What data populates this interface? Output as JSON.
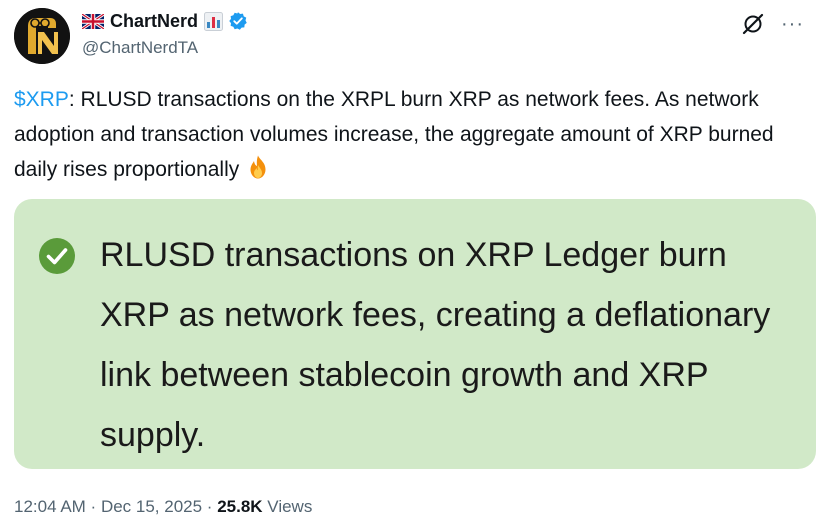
{
  "author": {
    "flag_icon": "uk-flag-icon",
    "display_name": "ChartNerd",
    "name_emoji_icon": "bar-chart-icon",
    "verified_icon": "verified-badge-icon",
    "handle": "@ChartNerdTA",
    "avatar_icon": "chartnerd-avatar-icon"
  },
  "actions": {
    "grok_icon": "grok-icon",
    "more_label": "···"
  },
  "tweet": {
    "cashtag": "$XRP",
    "body": ": RLUSD transactions on the XRPL burn XRP as network fees. As network adoption and transaction volumes increase, the aggregate amount of XRP burned daily rises proportionally",
    "trailing_emoji_icon": "fire-icon"
  },
  "card": {
    "icon": "check-mark-icon",
    "text": "RLUSD transactions on XRP Ledger burn XRP as network fees, creating a deflationary link between stablecoin growth and XRP supply.",
    "background_color": "#d1e9c8"
  },
  "footer": {
    "time": "12:04 AM",
    "separator": " · ",
    "date": "Dec 15, 2025",
    "views_count": "25.8K",
    "views_label": " Views"
  },
  "colors": {
    "link": "#1d9bf0",
    "secondary_text": "#536471",
    "check_green": "#5a9b3a"
  }
}
